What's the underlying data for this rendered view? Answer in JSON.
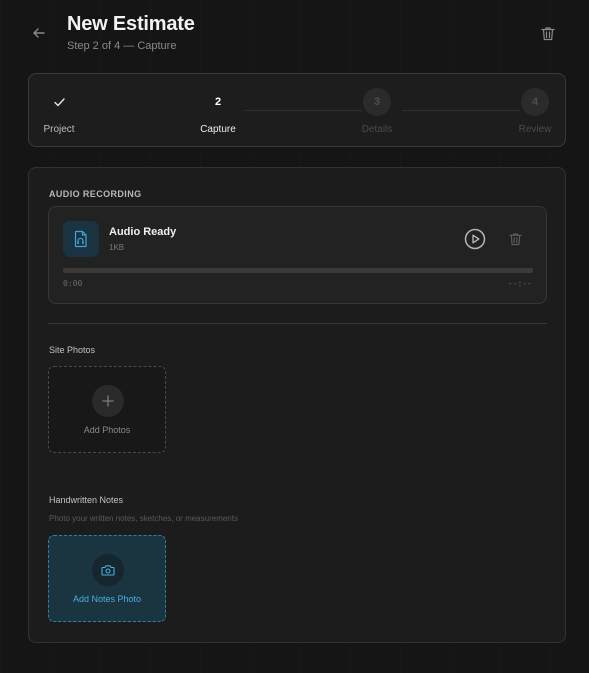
{
  "header": {
    "title": "New Estimate",
    "subtitle": "Step 2 of 4 — Capture"
  },
  "stepper": {
    "steps": [
      {
        "number": "✓",
        "label": "Project",
        "state": "done"
      },
      {
        "number": "2",
        "label": "Capture",
        "state": "current"
      },
      {
        "number": "3",
        "label": "Details",
        "state": "pending"
      },
      {
        "number": "4",
        "label": "Review",
        "state": "pending"
      }
    ]
  },
  "audio": {
    "section_title": "AUDIO RECORDING",
    "title": "Audio Ready",
    "size": "1KB",
    "progress": 0,
    "time_current": "0:00",
    "time_total": "--:--"
  },
  "photos": {
    "label": "Site Photos",
    "add_label": "Add Photos"
  },
  "notes": {
    "label": "Handwritten Notes",
    "hint": "Photo your written notes, sketches, or measurements",
    "add_label": "Add Notes Photo"
  },
  "colors": {
    "accent": "#4aaee0",
    "background": "#151515",
    "card": "#1c1c1c"
  },
  "icons": [
    "arrow-left-icon",
    "trash-icon",
    "check-icon",
    "audio-file-icon",
    "play-icon",
    "plus-icon",
    "camera-icon"
  ]
}
